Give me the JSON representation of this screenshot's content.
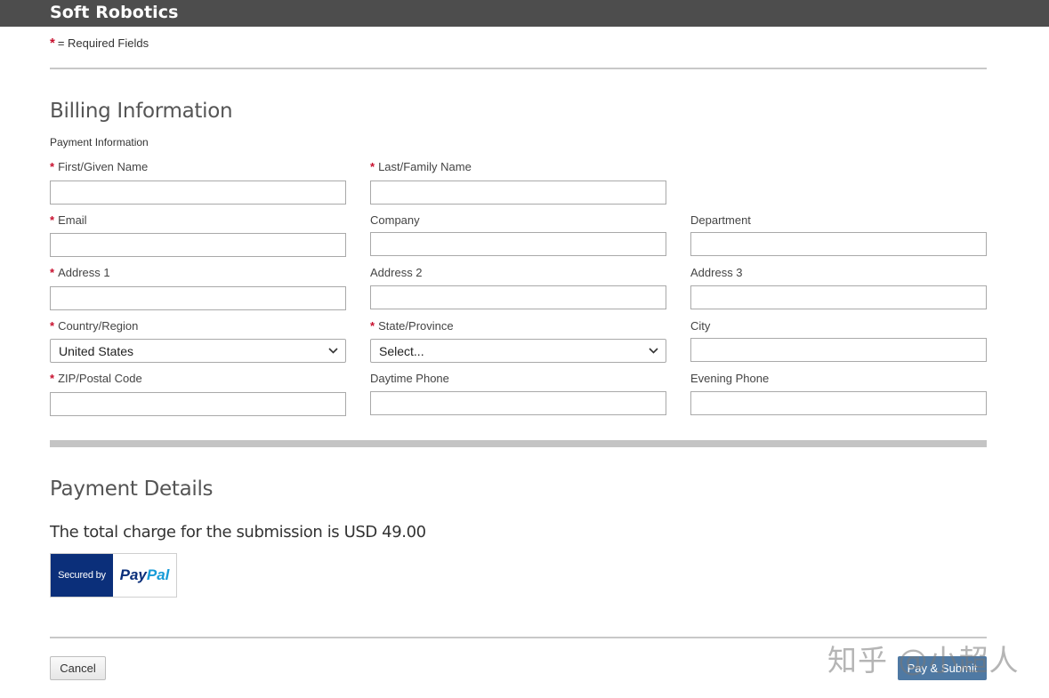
{
  "header": {
    "title": "Soft Robotics"
  },
  "required_note": {
    "star": "*",
    "text": "= Required Fields"
  },
  "billing": {
    "title": "Billing Information",
    "subtitle": "Payment Information",
    "fields": {
      "first_name": {
        "label": "First/Given Name",
        "required": true,
        "value": ""
      },
      "last_name": {
        "label": "Last/Family Name",
        "required": true,
        "value": ""
      },
      "email": {
        "label": "Email",
        "required": true,
        "value": ""
      },
      "company": {
        "label": "Company",
        "required": false,
        "value": ""
      },
      "department": {
        "label": "Department",
        "required": false,
        "value": ""
      },
      "address1": {
        "label": "Address 1",
        "required": true,
        "value": ""
      },
      "address2": {
        "label": "Address 2",
        "required": false,
        "value": ""
      },
      "address3": {
        "label": "Address 3",
        "required": false,
        "value": ""
      },
      "country": {
        "label": "Country/Region",
        "required": true,
        "value": "United States"
      },
      "state": {
        "label": "State/Province",
        "required": true,
        "value": "Select..."
      },
      "city": {
        "label": "City",
        "required": false,
        "value": ""
      },
      "zip": {
        "label": "ZIP/Postal Code",
        "required": true,
        "value": ""
      },
      "day_phone": {
        "label": "Daytime Phone",
        "required": false,
        "value": ""
      },
      "evening_phone": {
        "label": "Evening Phone",
        "required": false,
        "value": ""
      }
    }
  },
  "payment": {
    "title": "Payment Details",
    "total_text": "The total charge for the submission is USD 49.00",
    "badge": {
      "left": "Secured by",
      "brand_part1": "Pay",
      "brand_part2": "Pal"
    }
  },
  "actions": {
    "cancel": "Cancel",
    "submit": "Pay & Submit"
  },
  "watermark": "知乎 @小超人",
  "colors": {
    "header_bg": "#4d4d4d",
    "required_star": "#c8102e",
    "submit_bg": "#4f79a3",
    "paypal_navy": "#0b2f7a",
    "paypal_blue": "#179bd7"
  },
  "icons": {
    "select_arrow": "chevron-down-icon"
  }
}
